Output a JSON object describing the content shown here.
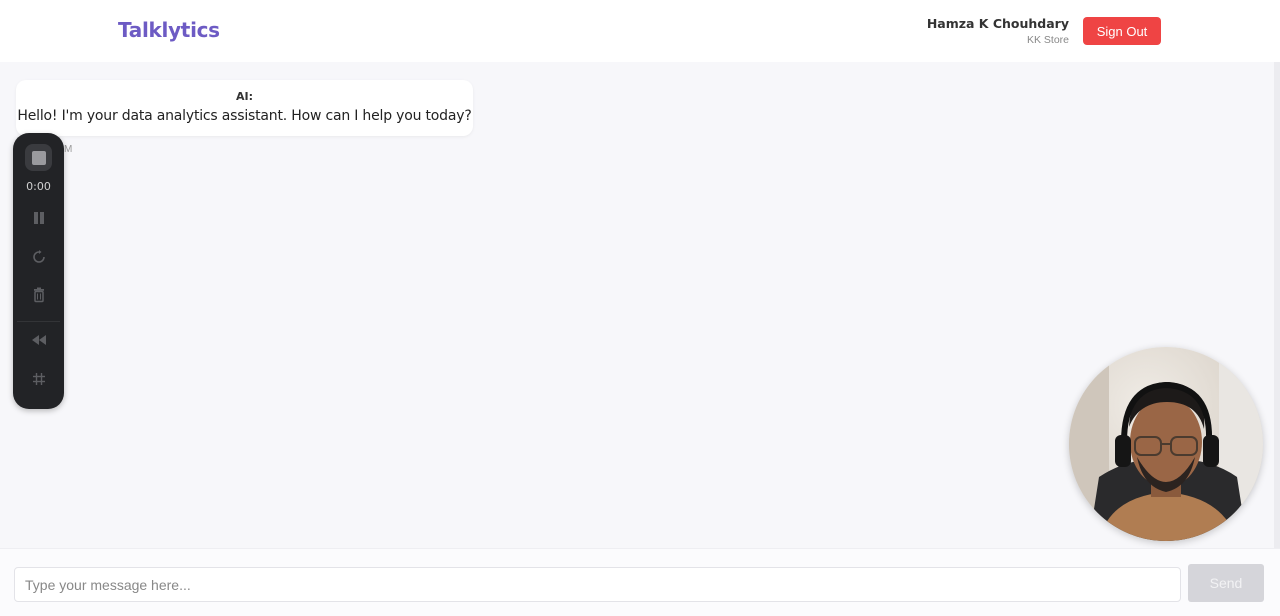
{
  "header": {
    "app_title": "Talklytics",
    "user_name": "Hamza K Chouhdary",
    "store_name": "KK Store",
    "sign_out_label": "Sign Out"
  },
  "chat": {
    "messages": [
      {
        "sender": "AI:",
        "text": "Hello! I'm your data analytics assistant. How can I help you today?",
        "time_fragment": "M"
      }
    ]
  },
  "recorder": {
    "timer": "0:00",
    "icons": [
      "stop-icon",
      "pause-icon",
      "restart-icon",
      "delete-icon",
      "rewind-icon",
      "hash-grid-icon"
    ]
  },
  "composer": {
    "placeholder": "Type your message here...",
    "send_label": "Send"
  },
  "colors": {
    "brand": "#6d5bc4",
    "sign_out": "#ef4444",
    "send_disabled": "#d5d5da",
    "recorder_bg": "#222326"
  }
}
